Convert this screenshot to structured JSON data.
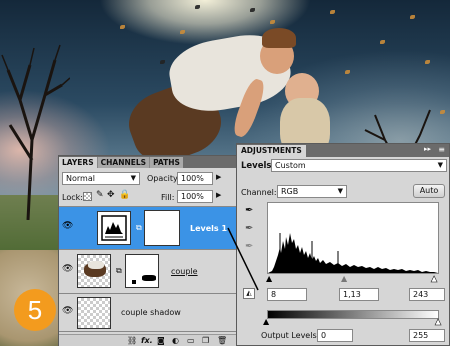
{
  "step_number": "5",
  "layers_panel": {
    "tabs": [
      "LAYERS",
      "CHANNELS",
      "PATHS"
    ],
    "blend_mode": "Normal",
    "opacity_label": "Opacity:",
    "opacity_value": "100%",
    "lock_label": "Lock:",
    "fill_label": "Fill:",
    "fill_value": "100%",
    "layers": [
      {
        "name": "Levels 1",
        "selected": true
      },
      {
        "name": "couple",
        "selected": false
      },
      {
        "name": "couple shadow",
        "selected": false
      }
    ],
    "footer_icons": [
      "link-icon",
      "fx-icon",
      "mask-icon",
      "adjustment-icon",
      "folder-icon",
      "new-layer-icon",
      "trash-icon"
    ],
    "footer_fx_label": "fx."
  },
  "adjustments_panel": {
    "title": "ADJUSTMENTS",
    "levels_label": "Levels",
    "preset_value": "Custom",
    "channel_label": "Channel:",
    "channel_value": "RGB",
    "auto_label": "Auto",
    "input_black": "8",
    "input_gamma": "1,13",
    "input_white": "243",
    "output_label": "Output Levels:",
    "output_black": "0",
    "output_white": "255"
  },
  "colors": {
    "selected_layer": "#3b93e6",
    "step_badge": "#f39b1e",
    "panel_bg": "#d6d6d6",
    "panel_header": "#6b6b6b"
  }
}
